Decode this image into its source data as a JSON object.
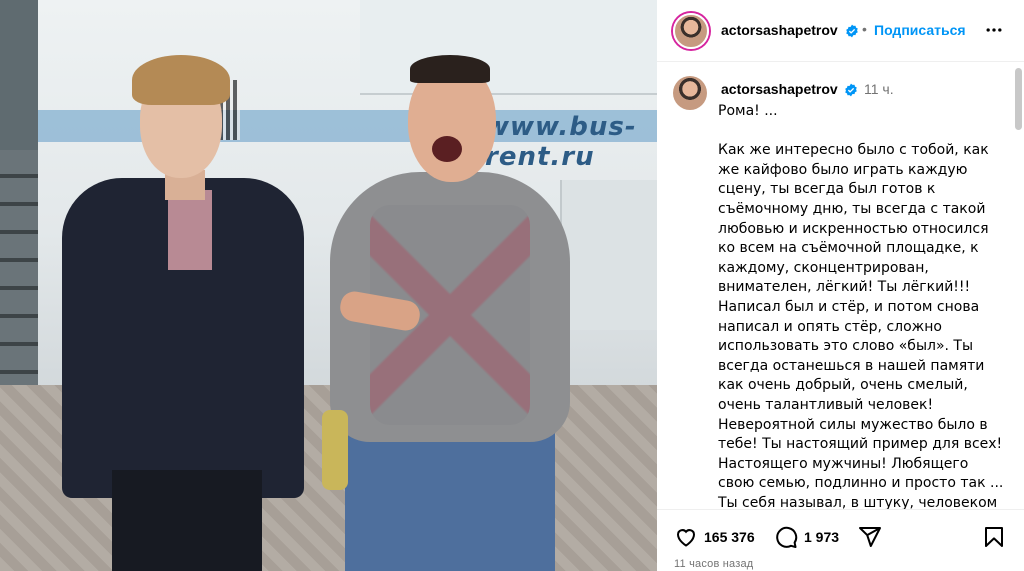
{
  "header": {
    "username": "actorsashapetrov",
    "separator": "•",
    "follow_label": "Подписаться",
    "more_icon": "more-horizontal-icon"
  },
  "post": {
    "username": "actorsashapetrov",
    "time": "11 ч.",
    "caption": "Рома! ...\n\nКак же интересно было с тобой, как же кайфово было играть каждую сцену, ты всегда был готов к съёмочному дню, ты всегда с такой любовью и искренностью относился ко всем на съёмочной площадке, к каждому, сконцентрирован, внимателен, лёгкий! Ты лёгкий!!! Написал был и стёр, и потом снова написал и опять стёр, сложно использовать это слово «был». Ты всегда останешься в нашей памяти как очень добрый, очень смелый, очень талантливый человек! Невероятной силы мужество было в тебе! Ты настоящий пример для всех! Настоящего мужчины! Любящего свою семью, подлинно и просто так ... Ты себя называл, в штуку, человеком"
  },
  "photo": {
    "bus_text": "www.bus-rent.ru"
  },
  "actions": {
    "likes": "165 376",
    "comments": "1 973",
    "icons": [
      "heart-icon",
      "comment-icon",
      "share-icon",
      "bookmark-icon"
    ]
  },
  "footer": {
    "time_ago": "11 часов назад"
  },
  "colors": {
    "link_blue": "#0095f6",
    "muted": "#737373",
    "verified": "#0095f6",
    "story_ring": "#d6249f"
  }
}
